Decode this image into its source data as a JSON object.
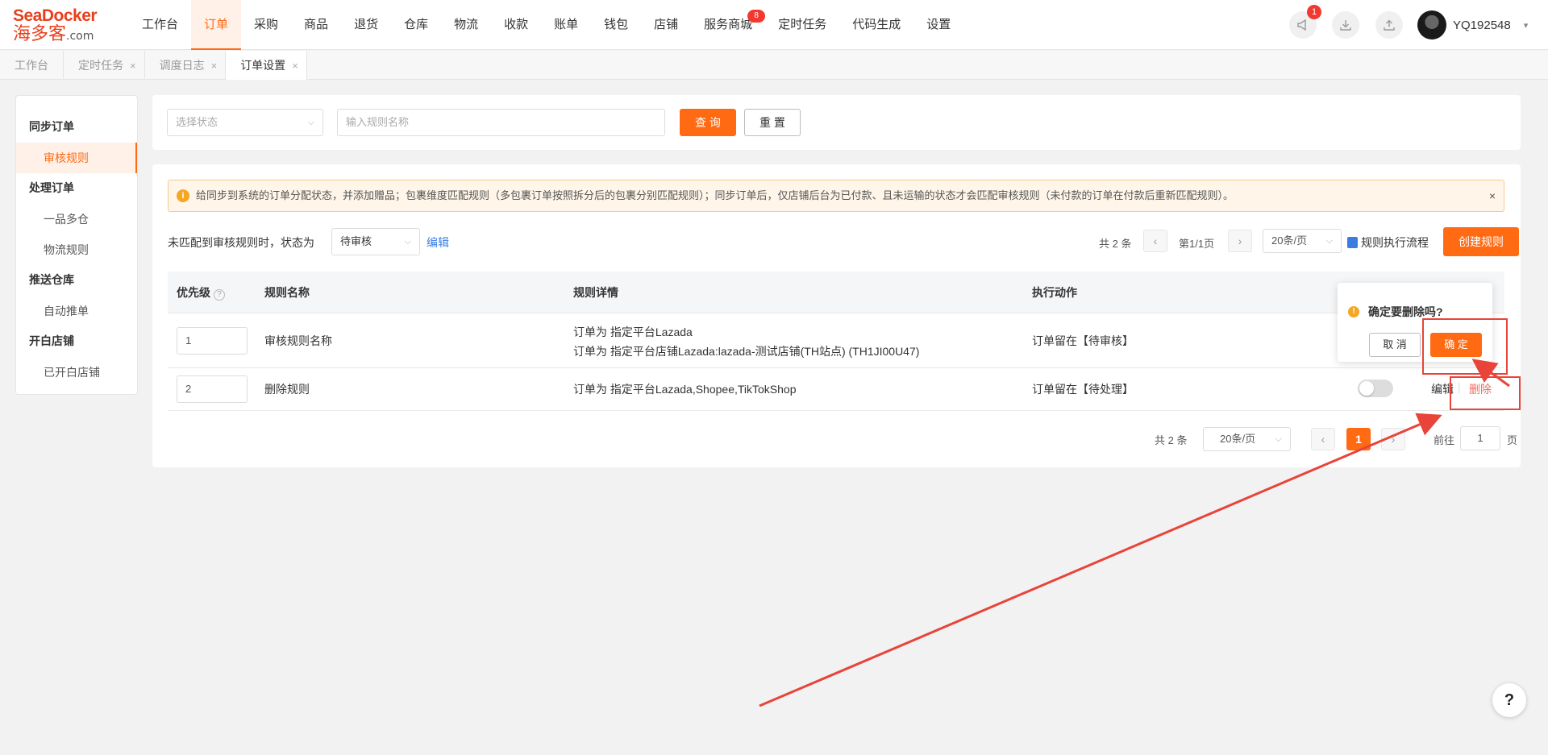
{
  "brand": {
    "line1": "SeaDocker",
    "line2": "海多客",
    "suffix": ".com"
  },
  "nav": {
    "items": [
      "工作台",
      "订单",
      "采购",
      "商品",
      "退货",
      "仓库",
      "物流",
      "收款",
      "账单",
      "钱包",
      "店铺",
      "服务商城",
      "定时任务",
      "代码生成",
      "设置"
    ],
    "active_index": 1,
    "service_badge": "8"
  },
  "topbar": {
    "notice_badge": "1",
    "username": "YQ192548"
  },
  "page_tabs": [
    {
      "label": "工作台",
      "closable": false,
      "active": false
    },
    {
      "label": "定时任务",
      "closable": true,
      "active": false
    },
    {
      "label": "调度日志",
      "closable": true,
      "active": false
    },
    {
      "label": "订单设置",
      "closable": true,
      "active": true
    }
  ],
  "close_glyph": "×",
  "left_menu": {
    "group1": "同步订单",
    "item1": "审核规则",
    "group2": "处理订单",
    "item2": "一品多仓",
    "item3": "物流规则",
    "group3": "推送仓库",
    "item4": "自动推单",
    "group4": "开白店铺",
    "item5": "已开白店铺"
  },
  "search": {
    "status_placeholder": "选择状态",
    "name_placeholder": "输入规则名称",
    "query_label": "查 询",
    "reset_label": "重 置"
  },
  "notice": {
    "text": "给同步到系统的订单分配状态，并添加赠品；包裹维度匹配规则（多包裹订单按照拆分后的包裹分别匹配规则）；同步订单后，仅店铺后台为已付款、且未运输的状态才会匹配审核规则（未付款的订单在付款后重新匹配规则）。",
    "close": "×"
  },
  "unmatched": {
    "label": "未匹配到审核规则时，状态为",
    "value": "待审核",
    "edit": "编辑"
  },
  "pager_top": {
    "total": "共 2 条",
    "page": "第1/1页",
    "size": "20条/页",
    "flow": "规则执行流程",
    "create": "创建规则"
  },
  "table": {
    "headers": {
      "priority": "优先级",
      "name": "规则名称",
      "detail": "规则详情",
      "action": "执行动作"
    },
    "rows": [
      {
        "priority": "1",
        "name": "审核规则名称",
        "detail1": "订单为 指定平台Lazada",
        "detail2": "订单为 指定平台店铺Lazada:lazada-测试店铺(TH站点) (TH1JI00U47)",
        "action": "订单留在【待审核】"
      },
      {
        "priority": "2",
        "name": "删除规则",
        "detail1": "订单为 指定平台Lazada,Shopee,TikTokShop",
        "action": "订单留在【待处理】",
        "edit": "编辑",
        "delete": "删除",
        "enabled": false
      }
    ]
  },
  "pager_bottom": {
    "total": "共 2 条",
    "size": "20条/页",
    "current": "1",
    "goto_label": "前往",
    "goto_value": "1",
    "page_unit": "页"
  },
  "popconfirm": {
    "icon": "!",
    "title": "确定要删除吗?",
    "cancel": "取 消",
    "confirm": "确 定"
  },
  "help": "?",
  "colors": {
    "primary": "#ff6a13",
    "annotation": "#e8443a",
    "link": "#3a7ce0"
  }
}
